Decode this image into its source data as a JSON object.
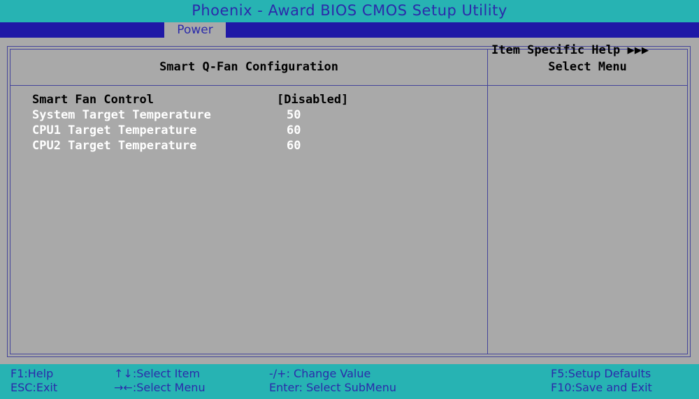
{
  "window": {
    "title": "Phoenix - Award BIOS CMOS Setup Utility"
  },
  "menu": {
    "active_tab": "Power"
  },
  "main": {
    "section_title": "Smart Q-Fan Configuration",
    "settings": [
      {
        "label": "Smart Fan Control",
        "value": "[Disabled]",
        "state": "selected"
      },
      {
        "label": "System Target Temperature",
        "value": "50",
        "state": "dimmed"
      },
      {
        "label": "CPU1 Target Temperature",
        "value": "60",
        "state": "dimmed"
      },
      {
        "label": "CPU2 Target Temperature",
        "value": "60",
        "state": "dimmed"
      }
    ]
  },
  "help_panel": {
    "title": "Select Menu",
    "text": "Item Specific Help ▶▶▶"
  },
  "footer": {
    "keys": [
      "F1:Help",
      "ESC:Exit",
      "↑↓:Select Item",
      "→←:Select Menu",
      "-/+: Change Value",
      "Enter: Select SubMenu",
      "F5:Setup Defaults",
      "F10:Save and Exit"
    ]
  },
  "colors": {
    "background": "#a9a9a9",
    "title_bar": "#27b3b3",
    "menu_bar": "#1f18a6",
    "accent_text": "#2b2baa",
    "dimmed_text": "#ffffff"
  }
}
